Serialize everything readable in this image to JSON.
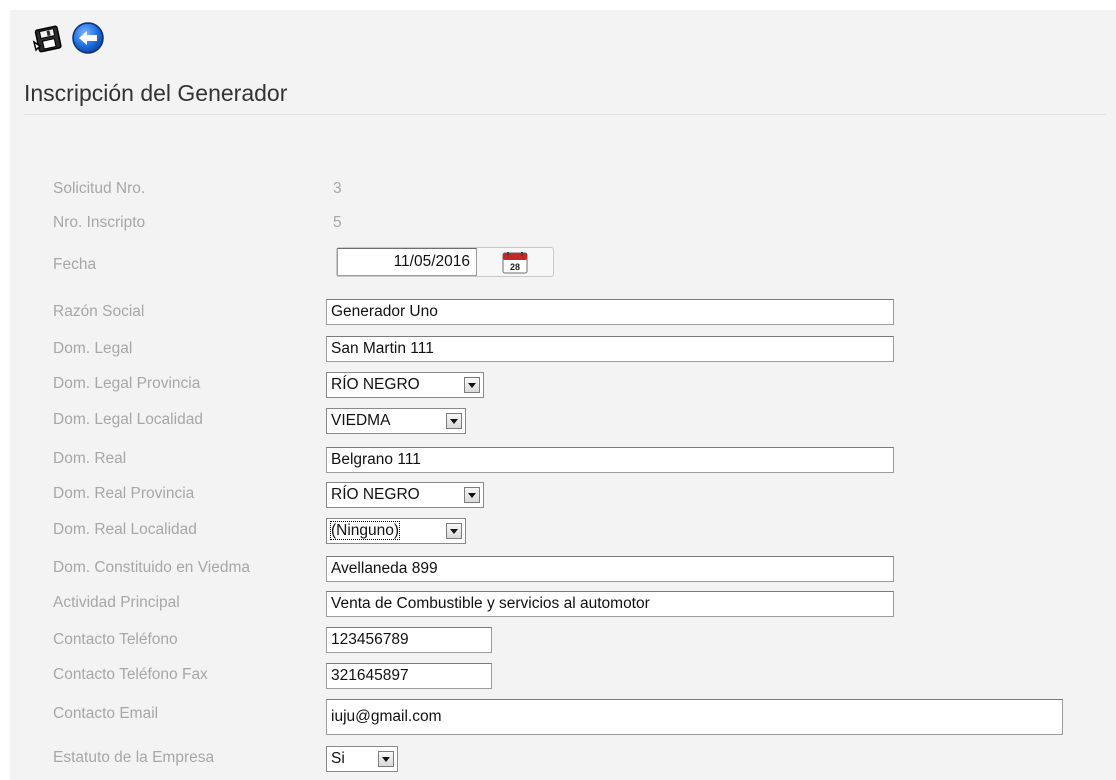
{
  "toolbar": {
    "save_icon": "save-disk-icon",
    "back_icon": "back-arrow-icon"
  },
  "page": {
    "title": "Inscripción del Generador"
  },
  "form": {
    "solicitud": {
      "label": "Solicitud Nro.",
      "value": "3"
    },
    "inscripto": {
      "label": "Nro. Inscripto",
      "value": "5"
    },
    "fecha": {
      "label": "Fecha",
      "value": "11/05/2016",
      "calendar_icon": "calendar-icon",
      "calendar_day": "28"
    },
    "razon_social": {
      "label": "Razón Social",
      "value": "Generador Uno"
    },
    "dom_legal": {
      "label": "Dom. Legal",
      "value": "San Martin 111"
    },
    "dom_legal_provincia": {
      "label": "Dom. Legal Provincia",
      "value": "RÍO NEGRO"
    },
    "dom_legal_localidad": {
      "label": "Dom. Legal Localidad",
      "value": "VIEDMA"
    },
    "dom_real": {
      "label": "Dom. Real",
      "value": "Belgrano 111"
    },
    "dom_real_provincia": {
      "label": "Dom. Real Provincia",
      "value": "RÍO NEGRO"
    },
    "dom_real_localidad": {
      "label": "Dom. Real Localidad",
      "value": "(Ninguno)"
    },
    "dom_constituido": {
      "label": "Dom. Constituido en Viedma",
      "value": "Avellaneda 899"
    },
    "actividad": {
      "label": "Actividad Principal",
      "value": "Venta de Combustible y servicios al automotor"
    },
    "telefono": {
      "label": "Contacto Teléfono",
      "value": "123456789"
    },
    "fax": {
      "label": "Contacto Teléfono Fax",
      "value": "321645897"
    },
    "email": {
      "label": "Contacto Email",
      "value": "iuju@gmail.com"
    },
    "estatuto": {
      "label": "Estatuto de la Empresa",
      "value": "Si"
    }
  },
  "colors": {
    "panel_bg": "#f3f3f3",
    "label_text": "#a7a7a7",
    "title_text": "#333333",
    "input_border": "#9c9c9c",
    "back_icon_blue": "#1f6fe0",
    "calendar_red": "#c62828"
  }
}
